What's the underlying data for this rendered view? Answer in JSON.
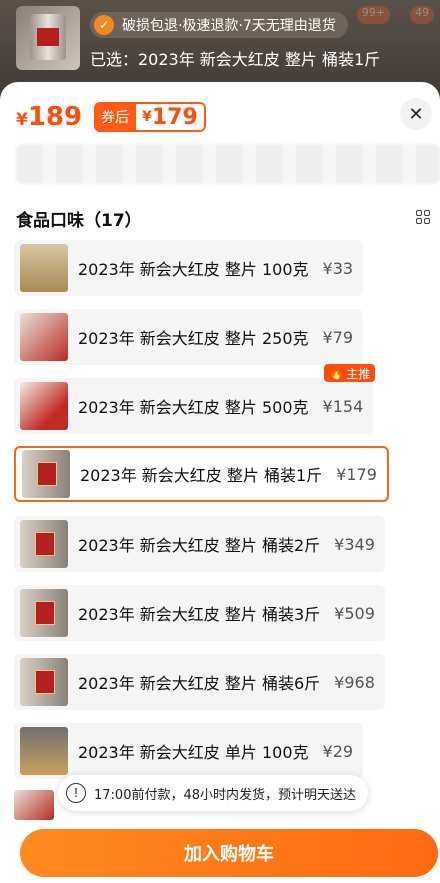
{
  "header": {
    "guarantee": "破损包退·极速退款·7天无理由退货",
    "chosen": "已选：2023年 新会大红皮 整片 桶装1斤",
    "badges": [
      "99+",
      "49"
    ]
  },
  "price": {
    "yen": "¥",
    "main": "189",
    "after_label": "券后",
    "after_price": "179"
  },
  "section": {
    "title": "食品口味（17）"
  },
  "options": [
    {
      "name": "2023年 新会大红皮 整片 100克",
      "price": "¥33"
    },
    {
      "name": "2023年 新会大红皮 整片 250克",
      "price": "¥79"
    },
    {
      "name": "2023年 新会大红皮 整片 500克",
      "price": "¥154",
      "tag": "主推"
    },
    {
      "name": "2023年 新会大红皮 整片 桶装1斤",
      "price": "¥179",
      "selected": true
    },
    {
      "name": "2023年 新会大红皮 整片 桶装2斤",
      "price": "¥349"
    },
    {
      "name": "2023年 新会大红皮 整片 桶装3斤",
      "price": "¥509"
    },
    {
      "name": "2023年 新会大红皮 整片 桶装6斤",
      "price": "¥968"
    },
    {
      "name": "2023年 新会大红皮 单片 100克",
      "price": "¥29"
    }
  ],
  "notice": "17:00前付款，48小时内发货，预计明天送达",
  "cart_button": "加入购物车",
  "colors": {
    "accent": "#ff5a14",
    "button": "#ff7a18"
  },
  "icons": {
    "close": "close-icon",
    "grid": "grid-view-icon",
    "guarantee": "shield-check-icon",
    "notice": "exclamation-icon",
    "hot": "flame-icon"
  }
}
